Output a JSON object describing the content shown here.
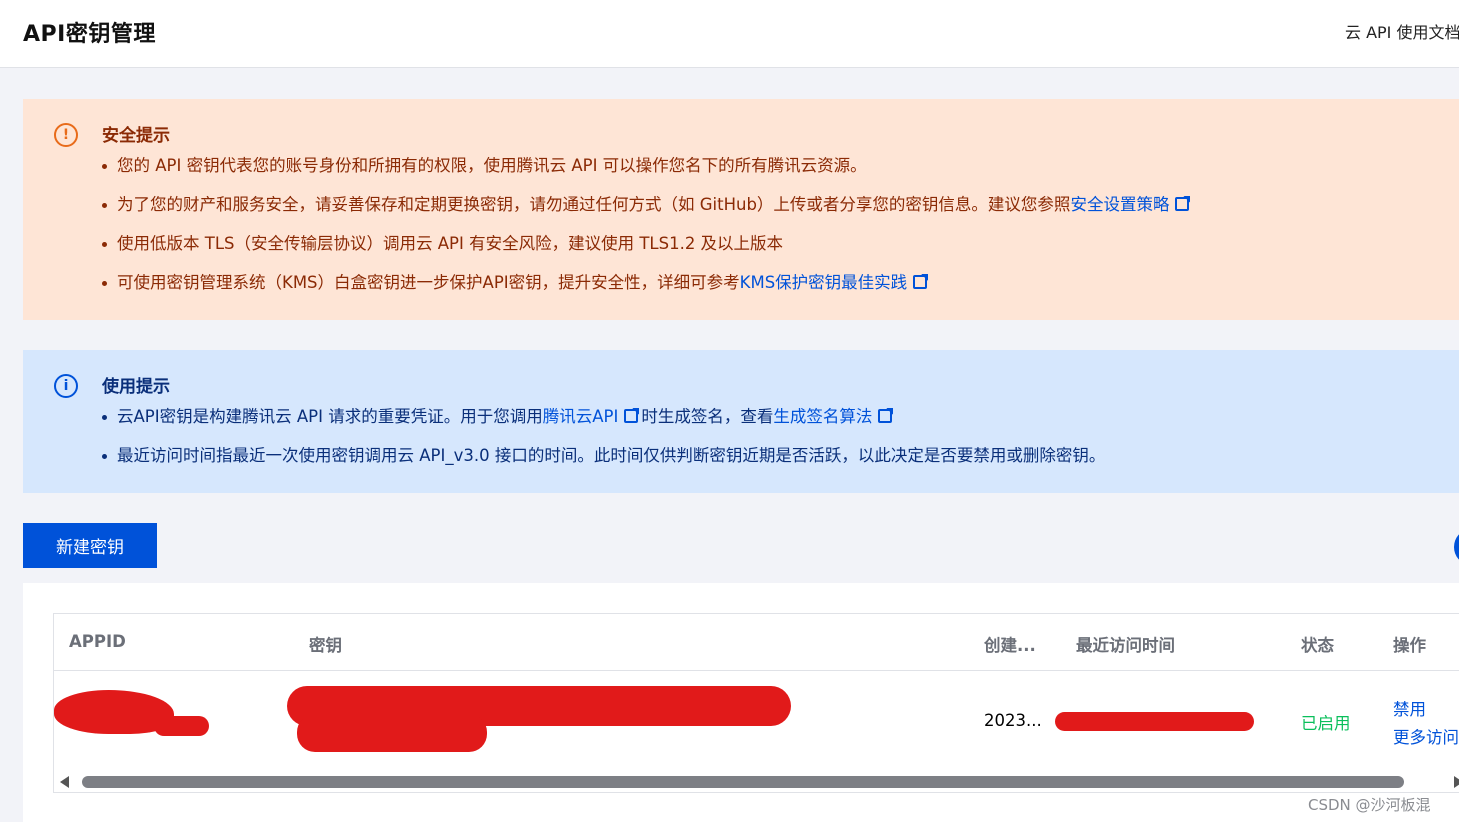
{
  "header": {
    "title": "API密钥管理",
    "docs_link": "云 API 使用文档"
  },
  "security_notice": {
    "icon": "warning-circle-icon",
    "title": "安全提示",
    "items": [
      {
        "text": "您的 API 密钥代表您的账号身份和所拥有的权限，使用腾讯云 API 可以操作您名下的所有腾讯云资源。"
      },
      {
        "text": "为了您的财产和服务安全，请妥善保存和定期更换密钥，请勿通过任何方式（如 GitHub）上传或者分享您的密钥信息。建议您参照",
        "link": "安全设置策略"
      },
      {
        "text": "使用低版本 TLS（安全传输层协议）调用云 API 有安全风险，建议使用 TLS1.2 及以上版本"
      },
      {
        "text": "可使用密钥管理系统（KMS）白盒密钥进一步保护API密钥，提升安全性，详细可参考",
        "link": "KMS保护密钥最佳实践"
      }
    ]
  },
  "usage_notice": {
    "icon": "info-circle-icon",
    "title": "使用提示",
    "items": [
      {
        "prefix": "云API密钥是构建腾讯云 API 请求的重要凭证。用于您调用",
        "link1": "腾讯云API",
        "middle": "时生成签名，查看",
        "link2": "生成签名算法"
      },
      {
        "text": "最近访问时间指最近一次使用密钥调用云 API_v3.0 接口的时间。此时间仅供判断密钥近期是否活跃，以此决定是否要禁用或删除密钥。"
      }
    ]
  },
  "actions": {
    "create_key": "新建密钥"
  },
  "table": {
    "columns": [
      "APPID",
      "密钥",
      "创建...",
      "最近访问时间",
      "状态",
      "操作"
    ],
    "rows": [
      {
        "appid": "",
        "secret": "",
        "created": "2023...",
        "last_access": "",
        "status": "已启用",
        "ops": [
          "禁用",
          "更多访问"
        ]
      }
    ]
  },
  "colors": {
    "primary": "#0052d9",
    "warning_bg": "#fee5d6",
    "info_bg": "#d6e7fd",
    "status_enabled": "#0abf5b",
    "redaction": "#e11a1a"
  },
  "watermark": "CSDN @沙河板混"
}
